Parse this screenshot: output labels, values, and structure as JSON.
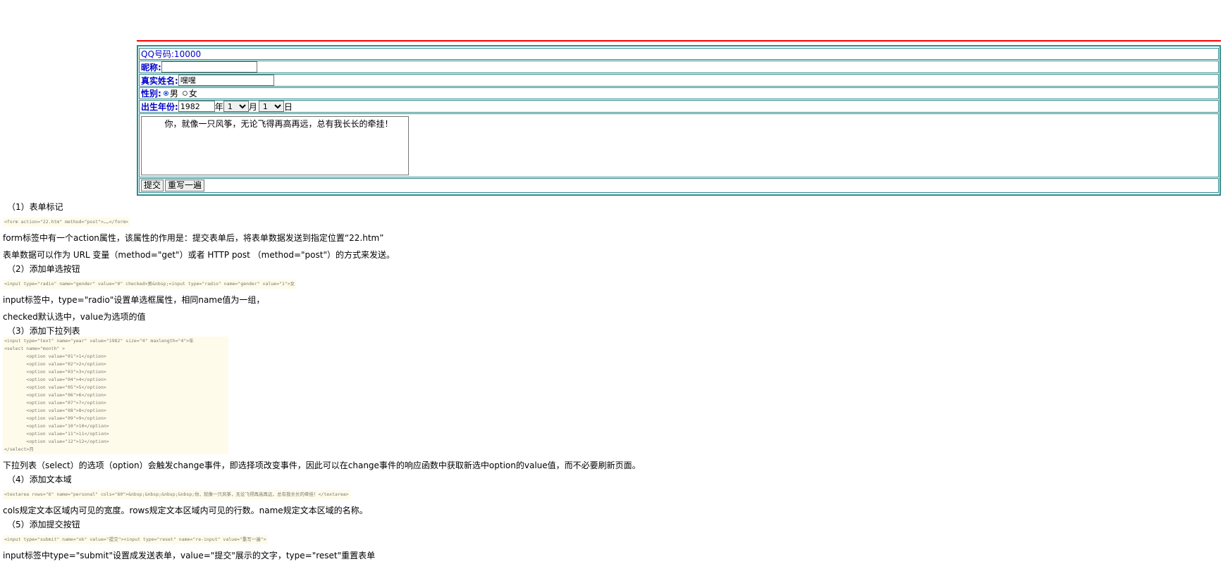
{
  "form": {
    "qq_label": "QQ号码:10000",
    "nickname_label": "昵称:",
    "nickname_value": "",
    "realname_label": "真实姓名:",
    "realname_value": "嘿嘿",
    "gender_label": "性别:",
    "gender_male": "男",
    "gender_female": "女",
    "birth_label": "出生年份:",
    "year_value": "1982",
    "year_unit": "年",
    "month_value": "1",
    "month_unit": "月",
    "day_value": "1",
    "day_unit": "日",
    "textarea_value": "        你，就像一只风筝，无论飞得再高再远，总有我长长的牵挂！",
    "submit_label": "提交",
    "reset_label": "重写一遍"
  },
  "notes": {
    "s1_title": "（1）表单标记",
    "s1_code": "<form action=\"22.htm\" method=\"post\">……</form>",
    "s1_p1": "form标签中有一个action属性，该属性的作用是：提交表单后，将表单数据发送到指定位置“22.htm”",
    "s1_p2": "表单数据可以作为 URL 变量（method=\"get\"）或者 HTTP post （method=\"post\"）的方式来发送。",
    "s2_title": "（2）添加单选按钮",
    "s2_code": "<input type=\"radio\" name=\"gender\" value=\"0\" checked>男&nbsp;<input type=\"radio\" name=\"gender\" value=\"1\">女",
    "s2_p1": "input标签中，type=\"radio\"设置单选框属性，相同name值为一组，",
    "s2_p2": "checked默认选中，value为选项的值",
    "s3_title": "（3）添加下拉列表",
    "s3_code": "<input type=\"text\" name=\"year\" value=\"1982\" size=\"4\" maxlength=\"4\">年\n<select name=\"month\" >\n        <option value=\"01\">1</option>\n        <option value=\"02\">2</option>\n        <option value=\"03\">3</option>\n        <option value=\"04\">4</option>\n        <option value=\"05\">5</option>\n        <option value=\"06\">6</option>\n        <option value=\"07\">7</option>\n        <option value=\"08\">8</option>\n        <option value=\"09\">9</option>\n        <option value=\"10\">10</option>\n        <option value=\"11\">11</option>\n        <option value=\"12\">12</option>\n</select>月",
    "s3_p1": "下拉列表（select）的选项（option）会触发change事件，即选择项改变事件，因此可以在change事件的响应函数中获取新选中option的value值，而不必要刷新页面。",
    "s4_title": "（4）添加文本域",
    "s4_code": "<textarea rows=\"6\" name=\"personal\" cols=\"60\">&nbsp;&nbsp;&nbsp;&nbsp;你，就像一只风筝，无论飞得再高再远，总有我长长的牵挂！</textarea>",
    "s4_p1": "cols规定文本区域内可见的宽度。rows规定文本区域内可见的行数。name规定文本区域的名称。",
    "s5_title": "（5）添加提交按钮",
    "s5_code": "<input type=\"submit\" name=\"ok\" value=\"提交\"><input type=\"reset\" name=\"re-input\" value=\"重写一遍\">",
    "s5_p1": "input标签中type=\"submit\"设置成发送表单，value=\"提交\"展示的文字，type=\"reset\"重置表单"
  }
}
